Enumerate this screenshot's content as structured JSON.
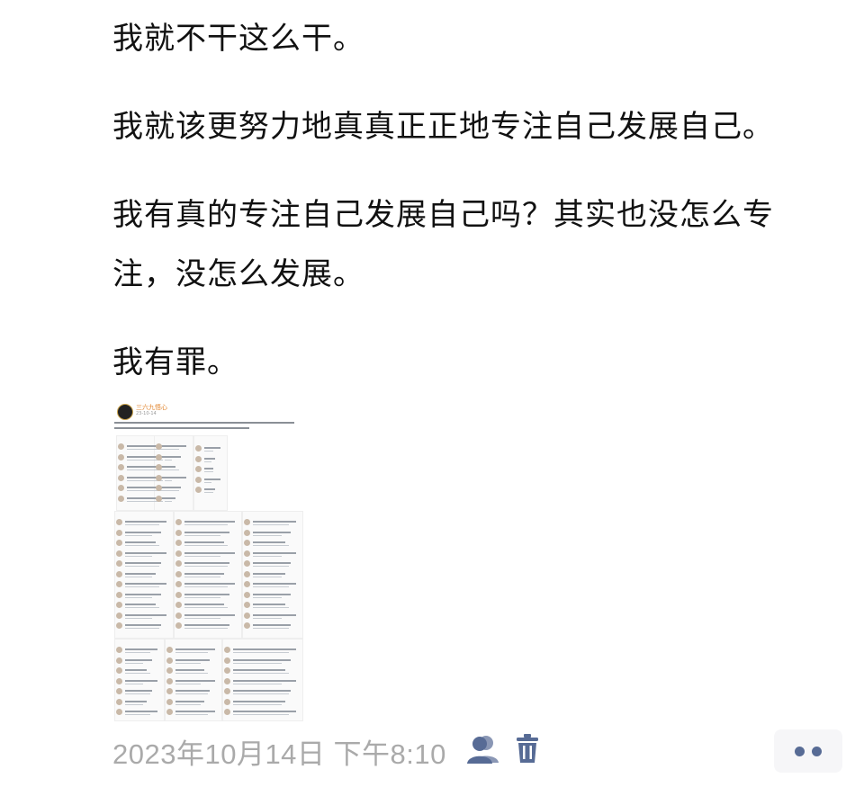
{
  "post": {
    "paragraphs": [
      "我就不干这么干。",
      "我就该更努力地真真正正地专注自己发展自己。",
      "我有真的专注自己发展自己吗？其实也没怎么专\n注，没怎么发展。",
      "我有罪。"
    ]
  },
  "attachment": {
    "author": "三六九悟心",
    "time": "23-10-14"
  },
  "meta": {
    "timestamp": "2023年10月14日 下午8:10",
    "visibility_icon": "friends-visibility-icon",
    "delete_icon": "trash-icon",
    "more_icon": "more-dots-icon"
  },
  "colors": {
    "text": "#111111",
    "timestamp": "#aaaaaa",
    "accent": "#576b95",
    "more_bg": "#f6f6f8"
  }
}
